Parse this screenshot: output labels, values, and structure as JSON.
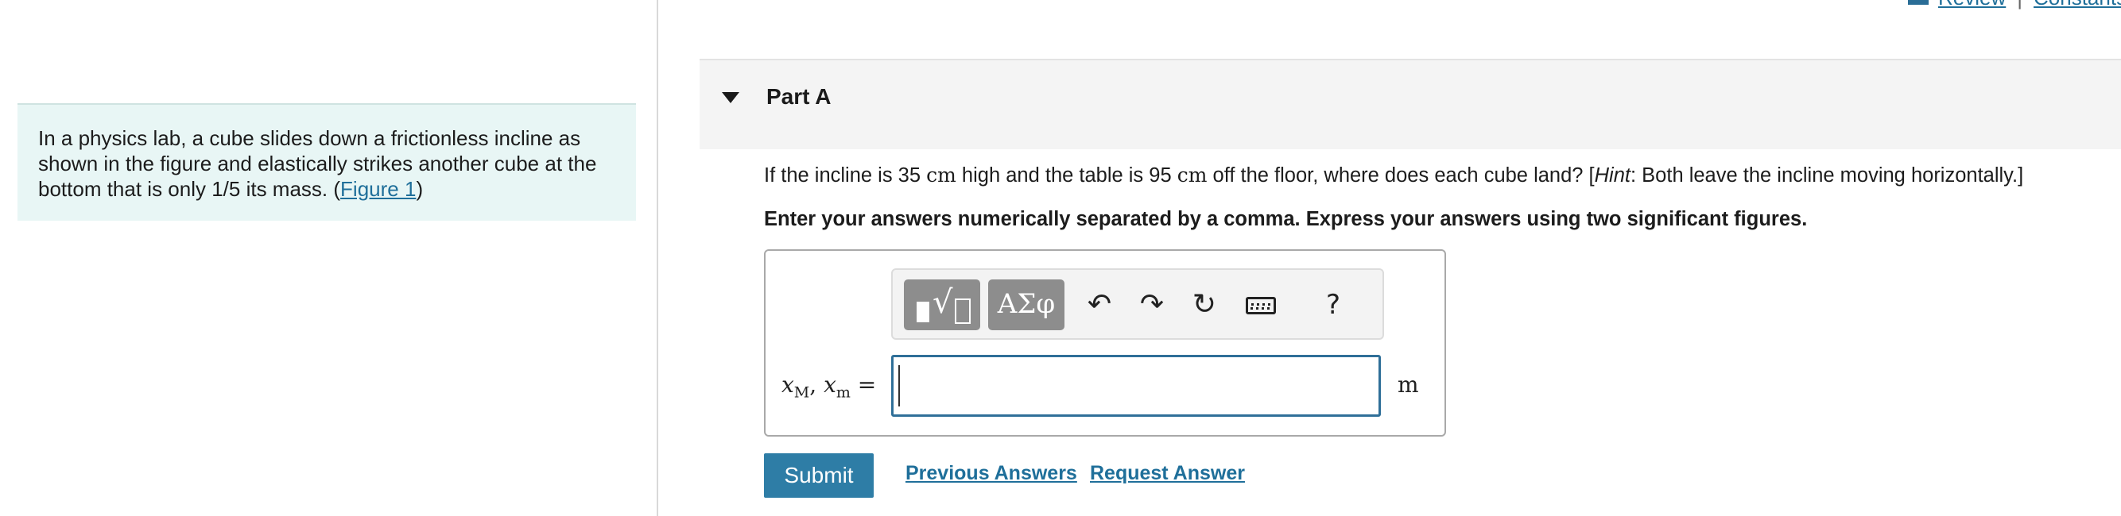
{
  "header_links": {
    "review": "Review",
    "separator": "|",
    "constants": "Constants"
  },
  "problem": {
    "text": "In a physics lab, a cube slides down a frictionless incline as shown in the figure and elastically strikes another cube at the bottom that is only 1/5 its mass. (",
    "figure_link": "Figure 1",
    "text_end": ")"
  },
  "part": {
    "title": "Part A"
  },
  "question": {
    "q1": "If the incline is 35 ",
    "unit1": "cm",
    "q2": " high and the table is 95 ",
    "unit2": "cm",
    "q3": " off the floor, where does each cube land? [",
    "hint_label": "Hint",
    "hint_text": ": Both leave the incline moving horizontally.]",
    "instruction": "Enter your answers numerically separated by a comma. Express your answers using two significant figures."
  },
  "toolbar": {
    "templates_icon": "sqrt-template-icon",
    "symbols_label": "ΑΣφ",
    "undo_icon": "undo-icon",
    "redo_icon": "redo-icon",
    "reset_icon": "reset-icon",
    "keyboard_icon": "keyboard-icon",
    "help_label": "?"
  },
  "answer": {
    "var1": "x",
    "sub1": "M",
    "comma": ", ",
    "var2": "x",
    "sub2": "m",
    "equals": " =",
    "value": "",
    "unit": "m"
  },
  "actions": {
    "submit": "Submit",
    "previous_answers": "Previous Answers",
    "request_answer": "Request Answer"
  },
  "colors": {
    "accent": "#2e7da6",
    "link": "#1f6f9a",
    "problem_bg": "#e8f6f5",
    "input_border": "#2f6f98"
  }
}
